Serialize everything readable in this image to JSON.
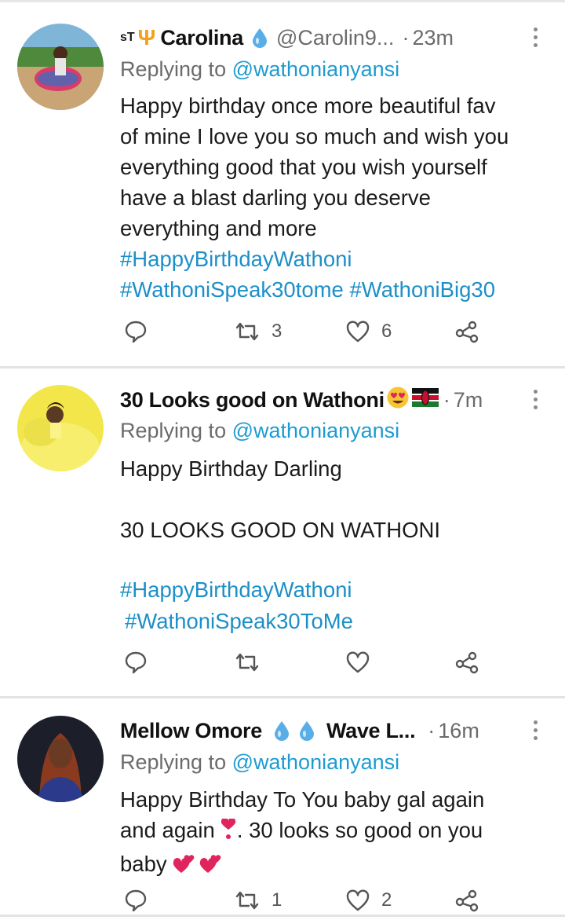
{
  "tweets": [
    {
      "name_prefix": "sT",
      "name_icon": "trident",
      "name": "Carolina",
      "handle": "@Carolin9...",
      "time_sep": "·",
      "time": "23m",
      "reply_prefix": "Replying to",
      "reply_to": "@wathonianyansi",
      "text": "Happy birthday once more beautiful fav\nof mine I love you so much and wish you\neverything good that you wish yourself\nhave a blast darling you deserve\neverything and more",
      "hashtags_line1": "#HappyBirthdayWathoni",
      "hashtags_line2": "#WathoniSpeak30tome #WathoniBig30",
      "retweets": "3",
      "likes": "6"
    },
    {
      "name": "30 Looks good on Wathoni",
      "time_sep": "·",
      "time": "7m",
      "reply_prefix": "Replying to",
      "reply_to": "@wathonianyansi",
      "text": "Happy Birthday Darling\n\n30 LOOKS GOOD ON WATHONI",
      "hashtags_line1": "#HappyBirthdayWathoni",
      "hashtags_line2": "#WathoniSpeak30ToMe",
      "retweets": "",
      "likes": ""
    },
    {
      "name": "Mellow Omore",
      "name_suffix": "Wave L...",
      "time_sep": "·",
      "time": "16m",
      "reply_prefix": "Replying to",
      "reply_to": "@wathonianyansi",
      "text_line1": "Happy Birthday To You baby gal again",
      "text_line2a": "and again",
      "text_line2b": ". 30 looks so good on you",
      "text_line3": "baby",
      "retweets": "1",
      "likes": "2"
    }
  ],
  "colors": {
    "link": "#1d9bd1",
    "muted": "#6b6b6b",
    "heart_emoji": "#e0245e"
  },
  "icons": [
    "reply-icon",
    "retweet-icon",
    "like-icon",
    "share-icon",
    "more-icon",
    "water-drop-icon",
    "heart-eyes-emoji",
    "kenya-flag-icon"
  ]
}
